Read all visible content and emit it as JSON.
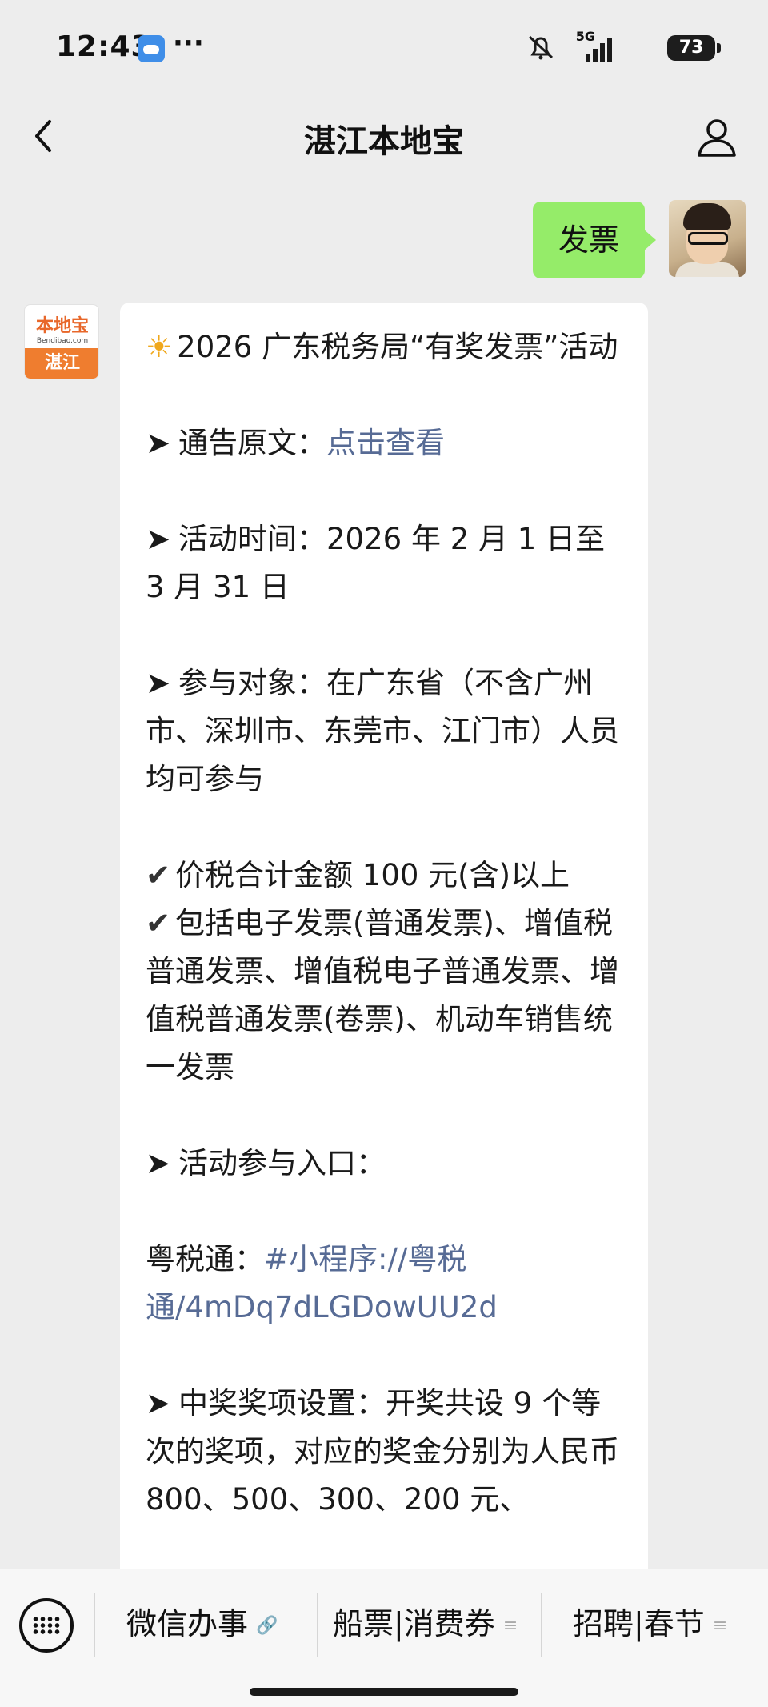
{
  "status_bar": {
    "time": "12:43",
    "dots": "···",
    "network": "5G",
    "battery": "73"
  },
  "nav": {
    "title": "湛江本地宝"
  },
  "user_message": {
    "text": "发票"
  },
  "bot_avatar": {
    "logo_text": "本地宝",
    "logo_sub": "Bendibao.com",
    "city": "湛江"
  },
  "bot_message": {
    "sun_icon": "☀",
    "title": "2026 广东税务局“有奖发票”活动",
    "notice_label": "通告原文：",
    "notice_link": "点击查看",
    "time_label": "活动时间：2026 年 2 月 1 日至 3 月 31 日",
    "target_text": "参与对象：在广东省（不含广州市、深圳市、东莞市、江门市）人员均可参与",
    "check_1": "价税合计金额 100 元(含)以上",
    "check_2": "包括电子发票(普通发票)、增值税普通发票、增值税电子普通发票、增值税普通发票(卷票)、机动车销售统一发票",
    "entry_label": "活动参与入口：",
    "yueshui_label": "粤税通：",
    "yueshui_link": "#小程序://粤税通/4mDq7dLGDowUU2d",
    "prize_text": "中奖奖项设置：开奖共设 9 个等次的奖项，对应的奖金分别为人民币 800、500、300、200 元、"
  },
  "bottom_menu": {
    "item_1": "微信办事",
    "item_2": "船票|消费券",
    "item_3": "招聘|春节",
    "link_suffix": "🔗",
    "menu_suffix": "≡"
  }
}
